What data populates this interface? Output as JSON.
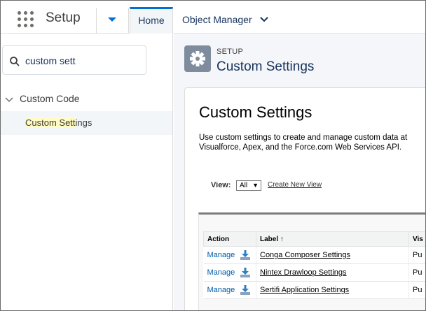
{
  "topbar": {
    "app_launcher_icon": "app-launcher-grid-icon",
    "app_title": "Setup",
    "tabs": [
      {
        "label": "Home",
        "active": true
      },
      {
        "label": "Object Manager",
        "active": false
      }
    ],
    "accent_color": "#0070d2"
  },
  "sidebar": {
    "search": {
      "value": "custom sett",
      "icon": "search-icon"
    },
    "tree": {
      "group_label": "Custom Code",
      "item_label_highlight": "Custom Sett",
      "item_label_rest": "ings"
    }
  },
  "main": {
    "header": {
      "eyebrow": "SETUP",
      "title": "Custom Settings",
      "icon": "gear-icon"
    },
    "content": {
      "title": "Custom Settings",
      "description": "Use custom settings to create and manage custom data at Visualforce, Apex, and the Force.com Web Services API.",
      "view_label": "View:",
      "view_selected": "All",
      "create_view_link": "Create New View"
    },
    "table": {
      "headers": [
        "Action",
        "Label ↑",
        "Vis"
      ],
      "rows": [
        {
          "action": "Manage",
          "label": "Conga Composer Settings",
          "visibility": "Pu"
        },
        {
          "action": "Manage",
          "label": "Nintex Drawloop Settings",
          "visibility": "Pu"
        },
        {
          "action": "Manage",
          "label": "Sertifi Application Settings",
          "visibility": "Pu"
        }
      ]
    }
  }
}
